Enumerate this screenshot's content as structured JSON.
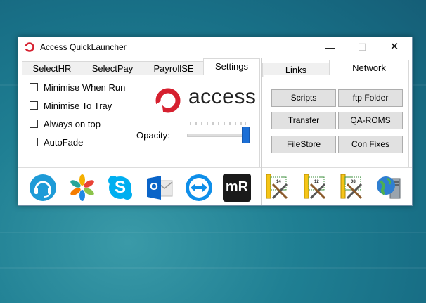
{
  "window": {
    "title": "Access QuickLauncher",
    "controls": {
      "minimize": "—",
      "maximize": "☐",
      "close": "✕"
    }
  },
  "left_tabs": [
    "SelectHR",
    "SelectPay",
    "PayrollSE",
    "Settings"
  ],
  "left_tabs_active": "Settings",
  "settings": {
    "checkboxes": [
      "Minimise When Run",
      "Minimise To Tray",
      "Always on top",
      "AutoFade"
    ],
    "logo_text": "access",
    "opacity_label": "Opacity:",
    "opacity_value": 1.0
  },
  "launch_icons": [
    "headset-support-icon",
    "colorful-star-app-icon",
    "skype-icon",
    "outlook-icon",
    "teamviewer-icon",
    "mremoteng-icon"
  ],
  "mremote_label": "mR",
  "outlook_letter": "O",
  "skype_letter": "S",
  "right_tabs": [
    "Links",
    "Network"
  ],
  "right_tabs_active": "Network",
  "network_buttons": [
    "Scripts",
    "ftp Folder",
    "Transfer",
    "QA-ROMS",
    "FileStore",
    "Con Fixes"
  ],
  "tool_versions": [
    "14",
    "12",
    "08"
  ],
  "colors": {
    "accent_red": "#d6202f",
    "slider_blue": "#1c6fd6",
    "button_bg": "#e1e1e1"
  }
}
